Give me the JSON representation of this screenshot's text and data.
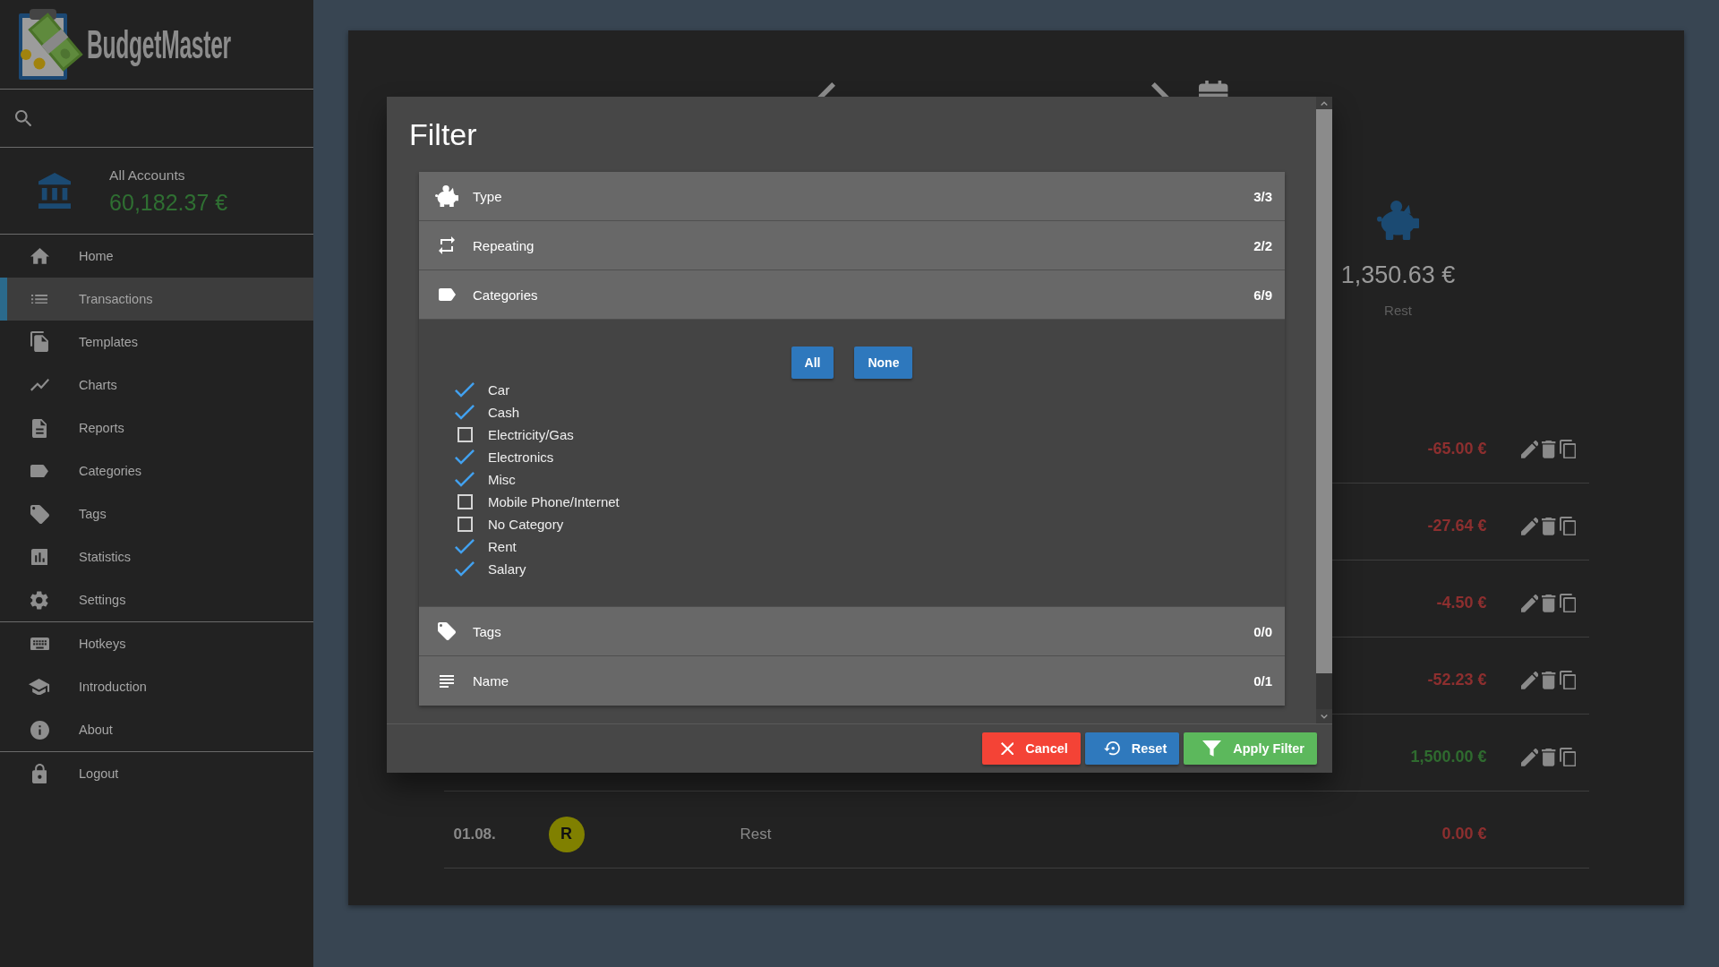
{
  "sidebar": {
    "logo_text": "BudgetMaster",
    "account": {
      "name": "All Accounts",
      "balance": "60,182.37 €"
    },
    "menu_sections": [
      {
        "items": [
          {
            "label": "Home",
            "selected": false
          },
          {
            "label": "Transactions",
            "selected": true
          },
          {
            "label": "Templates",
            "selected": false
          },
          {
            "label": "Charts",
            "selected": false
          },
          {
            "label": "Reports",
            "selected": false
          },
          {
            "label": "Categories",
            "selected": false
          },
          {
            "label": "Tags",
            "selected": false
          },
          {
            "label": "Statistics",
            "selected": false
          },
          {
            "label": "Settings",
            "selected": false
          }
        ]
      },
      {
        "items": [
          {
            "label": "Hotkeys",
            "selected": false
          },
          {
            "label": "Introduction",
            "selected": false
          },
          {
            "label": "About",
            "selected": false
          }
        ]
      },
      {
        "items": [
          {
            "label": "Logout",
            "selected": false
          }
        ]
      }
    ]
  },
  "page": {
    "summary": [
      {
        "amount": "1,350.63 €",
        "label": "Rest"
      }
    ],
    "transactions": [
      {
        "amount": "-65.00 €",
        "income": false,
        "editable": true
      },
      {
        "amount": "-27.64 €",
        "income": false,
        "editable": true
      },
      {
        "amount": "-4.50 €",
        "income": false,
        "editable": true
      },
      {
        "amount": "-52.23 €",
        "income": false,
        "editable": true
      },
      {
        "amount": "1,500.00 €",
        "income": true,
        "editable": true
      },
      {
        "date": "01.08.",
        "badge": "R",
        "color": "#808000",
        "description": "Rest",
        "amount": "0.00 €",
        "income": false,
        "editable": false
      }
    ]
  },
  "filter_dialog": {
    "title": "Filter",
    "sections": [
      {
        "label": "Type",
        "count": "3/3"
      },
      {
        "label": "Repeating",
        "count": "2/2"
      },
      {
        "label": "Categories",
        "count": "6/9",
        "buttons": [
          "All",
          "None"
        ],
        "options": [
          {
            "label": "Car",
            "checked": true
          },
          {
            "label": "Cash",
            "checked": true
          },
          {
            "label": "Electricity/Gas",
            "checked": false
          },
          {
            "label": "Electronics",
            "checked": true
          },
          {
            "label": "Misc",
            "checked": true
          },
          {
            "label": "Mobile Phone/Internet",
            "checked": false
          },
          {
            "label": "No Category",
            "checked": false
          },
          {
            "label": "Rent",
            "checked": true
          },
          {
            "label": "Salary",
            "checked": true
          }
        ]
      },
      {
        "label": "Tags",
        "count": "0/0"
      },
      {
        "label": "Name",
        "count": "0/1"
      }
    ],
    "buttons": [
      {
        "label": "Cancel",
        "kind": "cancel"
      },
      {
        "label": "Reset",
        "kind": "reset"
      },
      {
        "label": "Apply Filter",
        "kind": "apply"
      }
    ]
  }
}
